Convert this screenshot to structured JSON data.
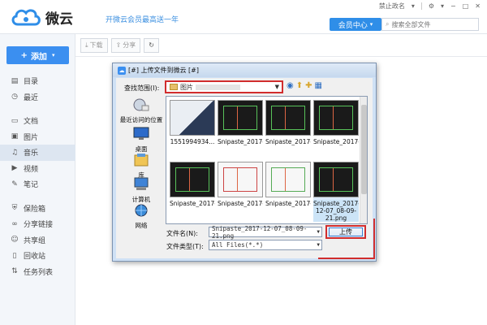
{
  "app": {
    "name": "微云",
    "promo": "开微云会员最高送一年",
    "vip_button": "会员中心",
    "search_placeholder": "搜索全部文件",
    "top_status": "禁止政名"
  },
  "sidebar": {
    "add_label": "添加",
    "items": [
      {
        "label": "目录",
        "icon": "folder-icon"
      },
      {
        "label": "最近",
        "icon": "clock-icon"
      },
      {
        "label": "文档",
        "icon": "document-icon"
      },
      {
        "label": "图片",
        "icon": "image-icon"
      },
      {
        "label": "音乐",
        "icon": "music-icon",
        "active": true
      },
      {
        "label": "视频",
        "icon": "video-icon"
      },
      {
        "label": "笔记",
        "icon": "note-icon"
      },
      {
        "label": "保险箱",
        "icon": "safe-icon"
      },
      {
        "label": "分享链接",
        "icon": "link-icon"
      },
      {
        "label": "共享组",
        "icon": "group-icon"
      },
      {
        "label": "回收站",
        "icon": "trash-icon"
      },
      {
        "label": "任务列表",
        "icon": "task-icon"
      }
    ]
  },
  "toolbar": {
    "download_label": "下载",
    "share_label": "分享"
  },
  "dialog": {
    "title": "[#] 上传文件到微云 [#]",
    "lookin_label": "查找范围(I):",
    "lookin_value": "图片",
    "places": [
      {
        "label": "最近访问的位置",
        "icon": "recent-places-icon"
      },
      {
        "label": "桌面",
        "icon": "desktop-icon"
      },
      {
        "label": "库",
        "icon": "library-icon"
      },
      {
        "label": "计算机",
        "icon": "computer-icon"
      },
      {
        "label": "网络",
        "icon": "network-icon"
      }
    ],
    "files": [
      {
        "caption": "1551994934..."
      },
      {
        "caption": "Snipaste_2017-..."
      },
      {
        "caption": "Snipaste_2017-..."
      },
      {
        "caption": "Snipaste_2017-..."
      },
      {
        "caption": "Snipaste_2017-..."
      },
      {
        "caption": "Snipaste_2017-..."
      },
      {
        "caption": "Snipaste_2017-..."
      },
      {
        "caption": "Snipaste_2017-12-07_08-09-21.png"
      }
    ],
    "filename_label": "文件名(N):",
    "filename_value": "Snipaste_2017-12-07_08-09-21.png",
    "filetype_label": "文件类型(T):",
    "filetype_value": "All Files(*.*)",
    "upload_label": "上传"
  }
}
